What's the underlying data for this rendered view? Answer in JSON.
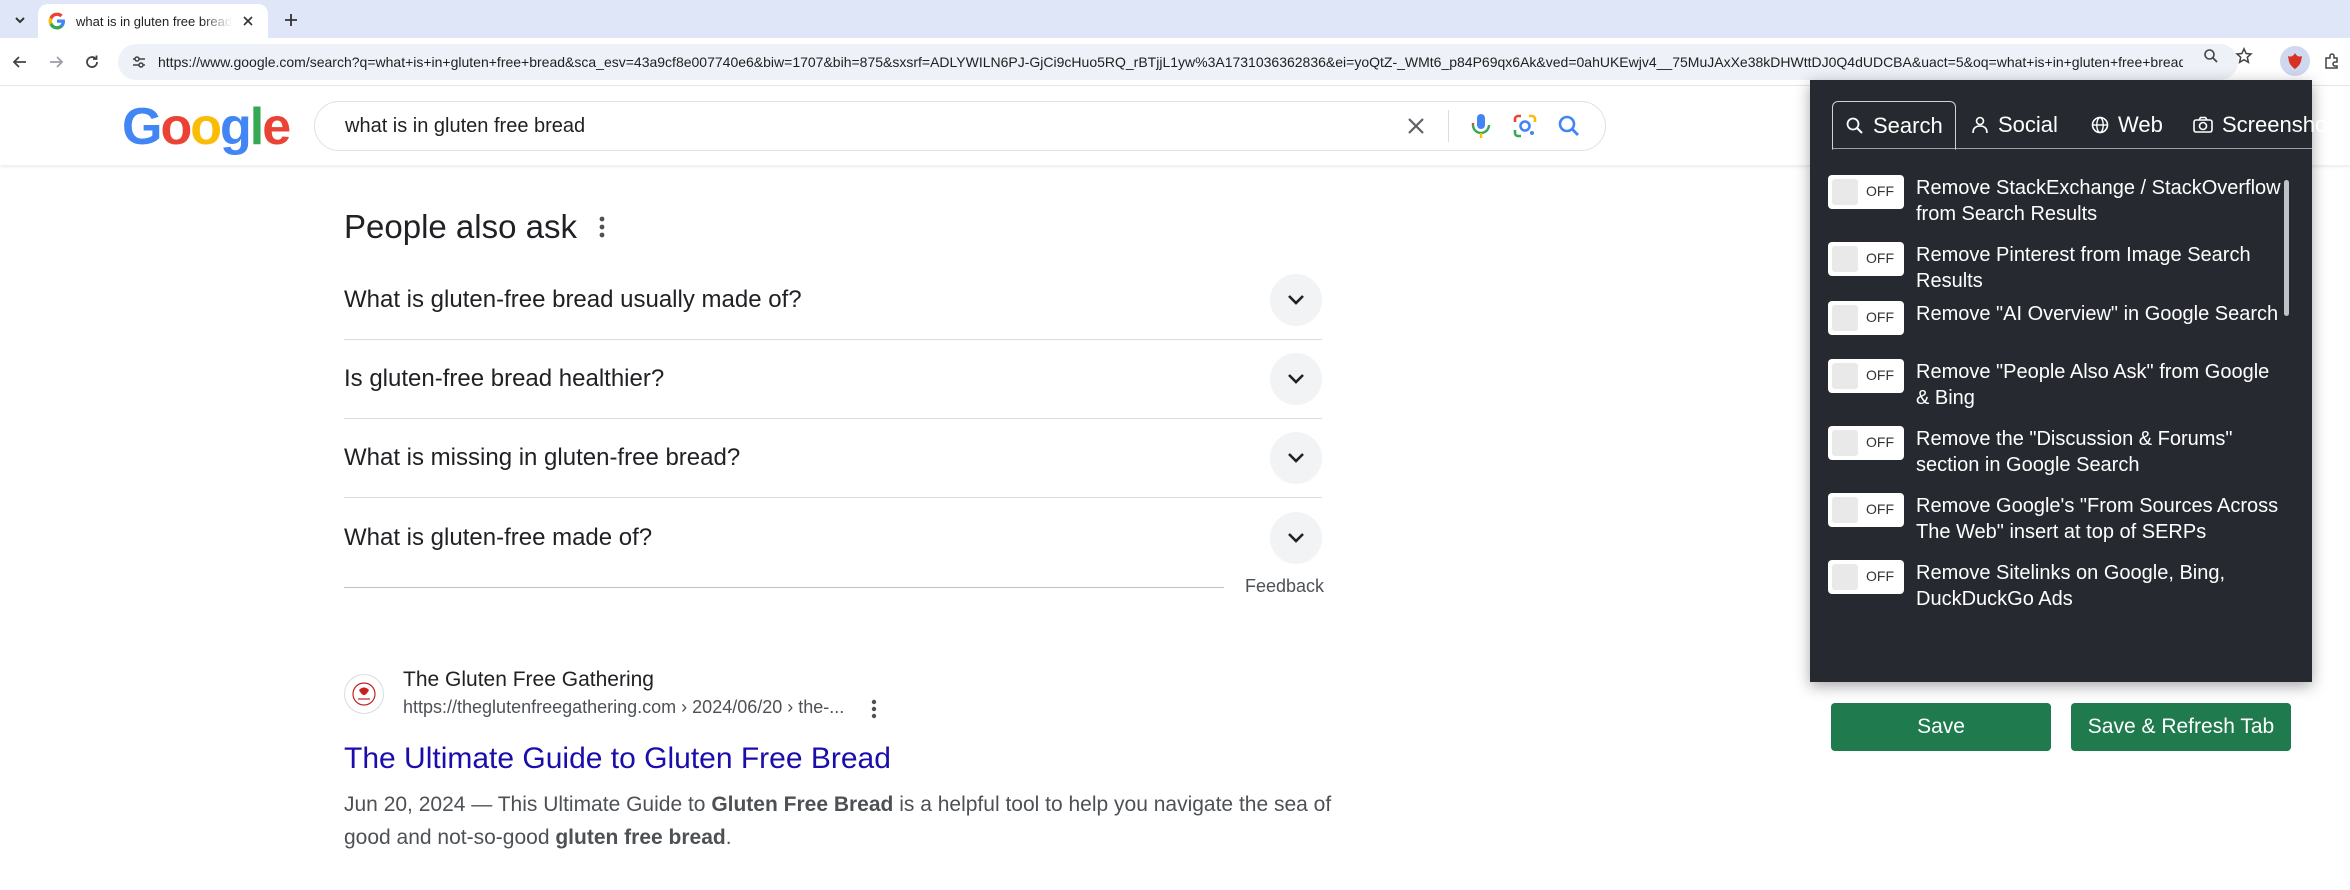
{
  "browser": {
    "tab_title": "what is in gluten free bread - G",
    "url": "https://www.google.com/search?q=what+is+in+gluten+free+bread&sca_esv=43a9cf8e007740e6&biw=1707&bih=875&sxsrf=ADLYWILN6PJ-GjCi9cHuo5RQ_rBTjjL1yw%3A1731036362836&ei=yoQtZ-_WMt6_p84P69qx6Ak&ved=0ahUKEwjv4__75MuJAxXe38kDHWttDJ0Q4dUDCBA&uact=5&oq=what+is+in+gluten+free+bread..."
  },
  "google": {
    "logo_letters": [
      "G",
      "o",
      "o",
      "g",
      "l",
      "e"
    ],
    "logo_colors": [
      "#4285F4",
      "#EA4335",
      "#FBBC05",
      "#4285F4",
      "#34A853",
      "#EA4335"
    ],
    "query": "what is in gluten free bread"
  },
  "paa": {
    "title": "People also ask",
    "questions": [
      "What is gluten-free bread usually made of?",
      "Is gluten-free bread healthier?",
      "What is missing in gluten-free bread?",
      "What is gluten-free made of?"
    ],
    "feedback": "Feedback"
  },
  "result": {
    "site_name": "The Gluten Free Gathering",
    "url": "https://theglutenfreegathering.com › 2024/06/20 › the-...",
    "title": "The Ultimate Guide to Gluten Free Bread",
    "snippet_date": "Jun 20, 2024",
    "snippet_parts": [
      " — This Ultimate Guide to ",
      "Gluten Free Bread",
      " is a helpful tool to help you navigate the sea of good and not-so-good ",
      "gluten free bread",
      "."
    ]
  },
  "extension": {
    "tabs": [
      "Search",
      "Social",
      "Web",
      "Screenshot"
    ],
    "active_tab": "Search",
    "toggle_state_label": "OFF",
    "options": [
      "Remove StackExchange / StackOverflow from Search Results",
      "Remove Pinterest from Image Search Results",
      "Remove \"AI Overview\" in Google Search",
      "Remove \"People Also Ask\" from Google & Bing",
      "Remove the \"Discussion & Forums\" section in Google Search",
      "Remove Google's \"From Sources Across The Web\" insert at top of SERPs",
      "Remove Sitelinks on Google, Bing, DuckDuckGo Ads"
    ],
    "save_label": "Save",
    "save_refresh_label": "Save & Refresh Tab",
    "accent_color": "#1f7a4d",
    "background_color": "#262a30"
  }
}
